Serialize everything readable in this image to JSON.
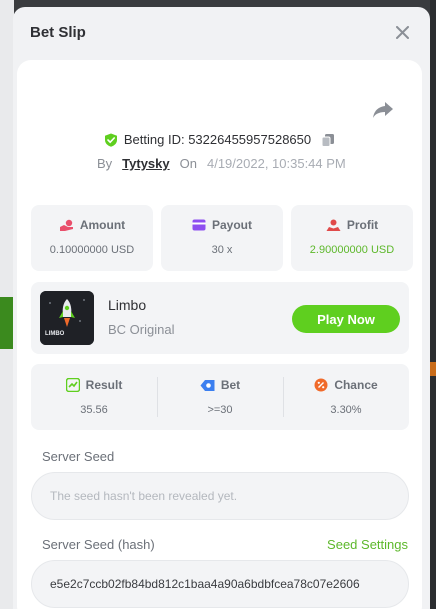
{
  "modal": {
    "title": "Bet Slip"
  },
  "bet": {
    "id_label": "Betting ID: 53226455957528650",
    "by_label": "By",
    "user": "Tytysky",
    "on_label": "On",
    "date": "4/19/2022, 10:35:44 PM"
  },
  "stats": [
    {
      "label": "Amount",
      "value": "0.10000000 USD",
      "icon": "amount-icon",
      "color": "#e94f6b"
    },
    {
      "label": "Payout",
      "value": "30 x",
      "icon": "payout-icon",
      "color": "#8e4ff0"
    },
    {
      "label": "Profit",
      "value": "2.90000000 USD",
      "icon": "profit-icon",
      "color": "#e04a4a"
    }
  ],
  "game": {
    "name": "Limbo",
    "subtitle": "BC Original",
    "thumb_text": "LIMBO",
    "play_label": "Play Now"
  },
  "result": [
    {
      "label": "Result",
      "value": "35.56",
      "icon": "result-icon",
      "color": "#5fcf1f"
    },
    {
      "label": "Bet",
      "value": ">=30",
      "icon": "bet-icon",
      "color": "#3b7ff0"
    },
    {
      "label": "Chance",
      "value": "3.30%",
      "icon": "chance-icon",
      "color": "#f06a2a"
    }
  ],
  "server_seed": {
    "label": "Server Seed",
    "placeholder": "The seed hasn't been revealed yet."
  },
  "server_seed_hash": {
    "label": "Server Seed (hash)",
    "settings_label": "Seed Settings",
    "value": "e5e2c7ccb02fb84bd812c1baa4a90a6bdbfcea78c07e2606"
  },
  "colors": {
    "accent_green": "#5fcf1f",
    "profit_green": "#5db82b"
  }
}
